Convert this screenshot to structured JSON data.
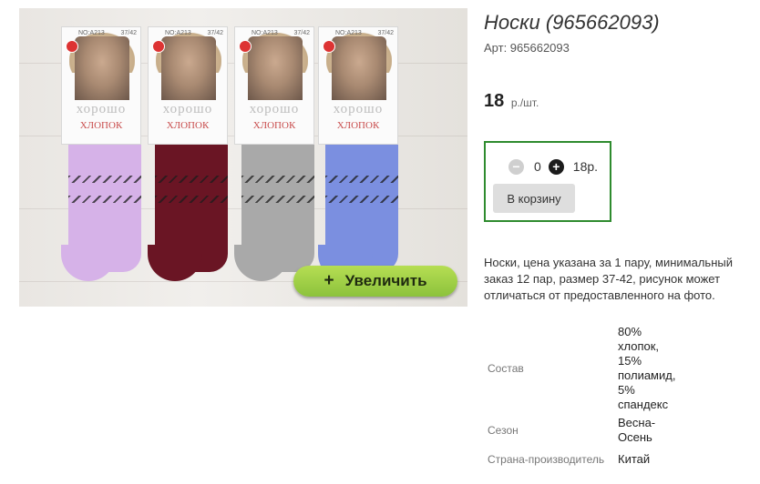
{
  "product": {
    "title": "Носки (965662093)",
    "article": "Арт: 965662093",
    "price": "18",
    "price_unit": "р./шт.",
    "description": "Носки, цена указана за 1 пару, минимальный заказ 12 пар, размер 37-42, рисунок может отличаться от предоставленного на фото."
  },
  "photo": {
    "zoom_label": "Увеличить",
    "zoom_icon": "plus-icon",
    "package_brand": "хорошо",
    "package_material": "ХЛОПОК",
    "package_code": "NO:A213",
    "package_size": "37/42",
    "sock_colors": [
      "#d6b2e8",
      "#6a1524",
      "#a9a9a9",
      "#7b8fe0"
    ]
  },
  "cart": {
    "minus_icon": "minus-circle-icon",
    "quantity": "0",
    "plus_icon": "plus-circle-icon",
    "sum": "18р.",
    "button_label": "В корзину",
    "border_color": "#2e8b2e"
  },
  "specs": [
    {
      "label": "Состав",
      "value": "80%\nхлопок,\n15%\nполиамид,\n5%\nспандекс"
    },
    {
      "label": "Сезон",
      "value": "Весна-\nОсень"
    },
    {
      "label": "Страна-производитель",
      "value": "Китай"
    }
  ]
}
